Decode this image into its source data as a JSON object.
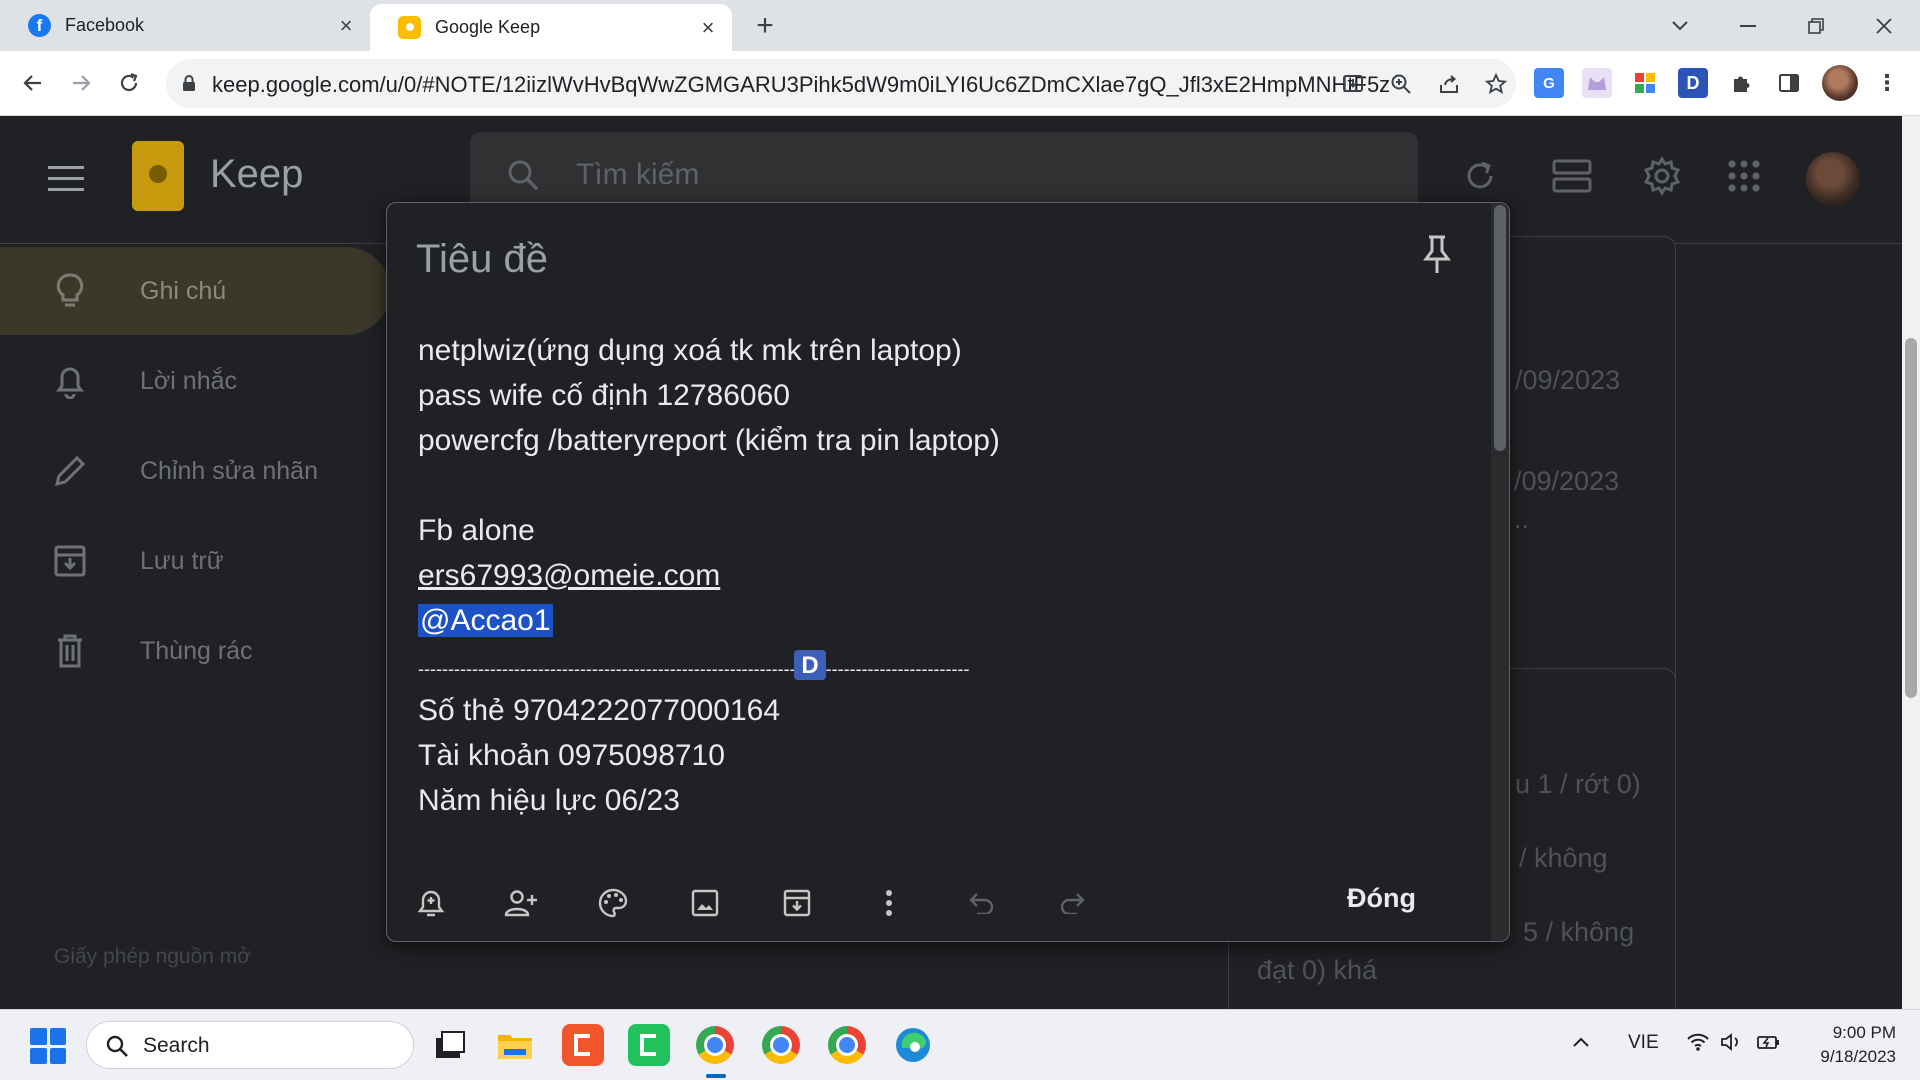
{
  "browser": {
    "tabs": [
      {
        "title": "Facebook",
        "active": false
      },
      {
        "title": "Google Keep",
        "active": true
      }
    ],
    "url": "keep.google.com/u/0/#NOTE/12iizlWvHvBqWwZGMGARU3Pihk5dW9m0iLYI6Uc6ZDmCXlae7gQ_Jfl3xE2HmpMNHtF5z",
    "extension_badges": [
      "D"
    ]
  },
  "keep": {
    "app_name": "Keep",
    "search_placeholder": "Tìm kiếm",
    "sidebar": {
      "items": [
        {
          "label": "Ghi chú",
          "icon": "lightbulb-icon",
          "active": true
        },
        {
          "label": "Lời nhắc",
          "icon": "bell-icon",
          "active": false
        },
        {
          "label": "Chỉnh sửa nhãn",
          "icon": "pencil-icon",
          "active": false
        },
        {
          "label": "Lưu trữ",
          "icon": "archive-icon",
          "active": false
        },
        {
          "label": "Thùng rác",
          "icon": "trash-icon",
          "active": false
        }
      ],
      "license": "Giấy phép nguồn mở"
    },
    "background_fragments": {
      "date_1": "/09/2023",
      "date_2": "/09/2023",
      "ellipsis": "..",
      "frag_1": "u 1 / rớt 0)",
      "frag_2": "/ không",
      "frag_3": "5 / không",
      "frag_4": "đạt 0) khá"
    },
    "editor": {
      "title_placeholder": "Tiêu đề",
      "lines": {
        "l1": "netplwiz(ứng dụng xoá tk mk trên laptop)",
        "l2": "pass wife cố định 12786060",
        "l3": "powercfg /batteryreport (kiểm tra pin laptop)",
        "l4": "Fb alone",
        "l5": "ers67993@omeie.com",
        "l6": "@Accao1",
        "l7": "--------------------------------------------------------------------------------------------",
        "l8": "Số thẻ 9704222077000164",
        "l9": "Tài khoản 0975098710",
        "l10": "Năm hiệu lực 06/23"
      },
      "badge": "D",
      "close_label": "Đóng"
    }
  },
  "taskbar": {
    "search_label": "Search",
    "language": "VIE",
    "time": "9:00 PM",
    "date": "9/18/2023"
  },
  "colors": {
    "keep_bg": "#202124",
    "sidebar_active": "#3b3729",
    "selection": "#1c52c6",
    "keep_yellow": "#c89a0e"
  }
}
